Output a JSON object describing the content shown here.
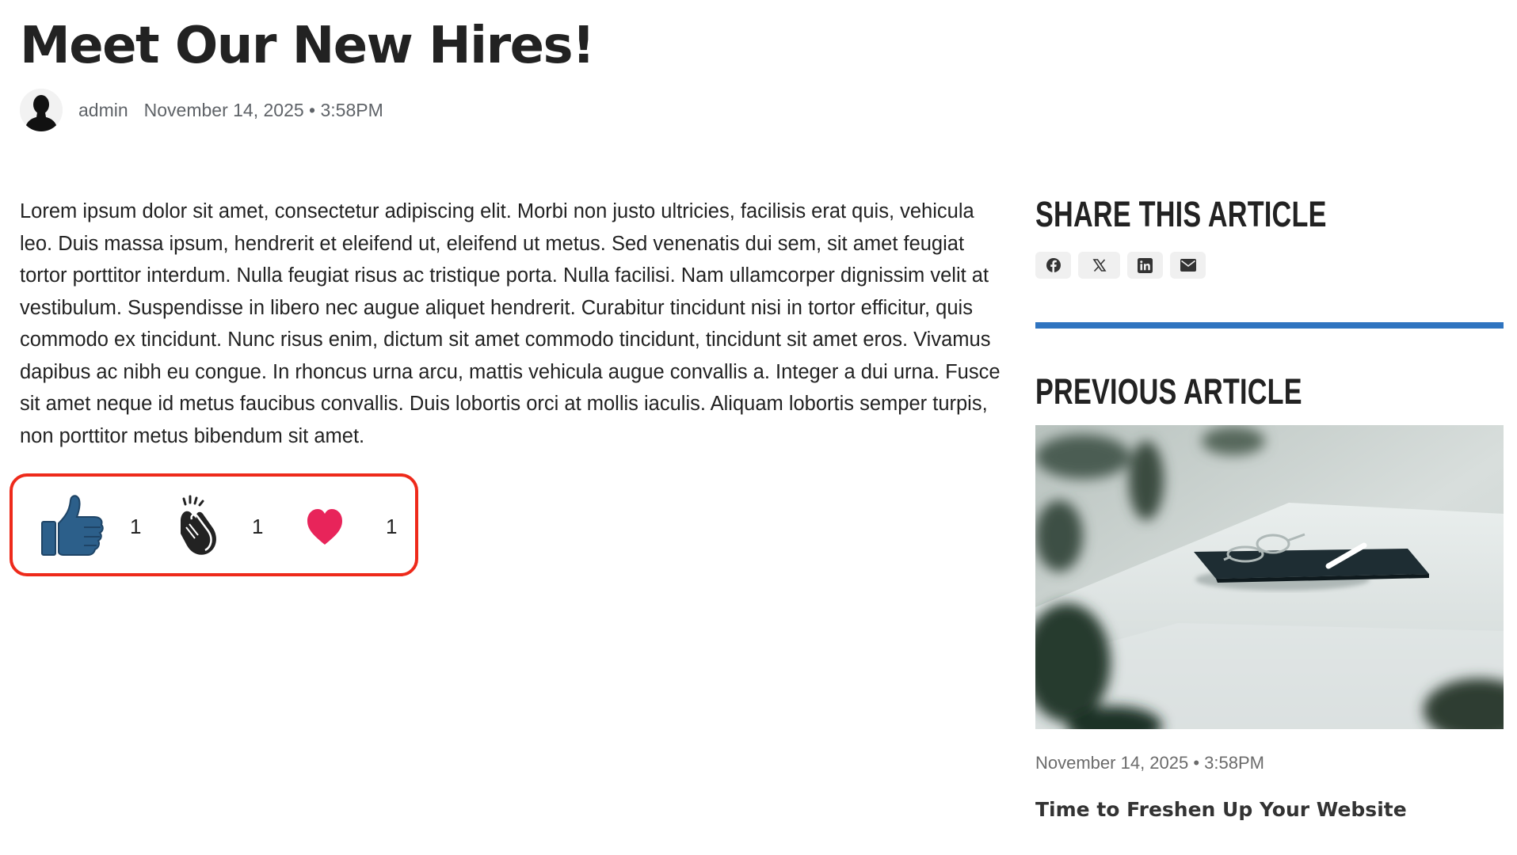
{
  "post": {
    "title": "Meet Our New Hires!",
    "author": "admin",
    "date": "November 14, 2025 • 3:58PM",
    "body": "Lorem ipsum dolor sit amet, consectetur adipiscing elit. Morbi non justo ultricies, facilisis erat quis, vehicula leo. Duis massa ipsum, hendrerit et eleifend ut, eleifend ut metus. Sed venenatis dui sem, sit amet feugiat tortor porttitor interdum. Nulla feugiat risus ac tristique porta. Nulla facilisi. Nam ullamcorper dignissim velit at vestibulum. Suspendisse in libero nec augue aliquet hendrerit. Curabitur tincidunt nisi in tortor efficitur, quis commodo ex tincidunt. Nunc risus enim, dictum sit amet commodo tincidunt, tincidunt sit amet eros. Vivamus dapibus ac nibh eu congue. In rhoncus urna arcu, mattis vehicula augue convallis a. Integer a dui urna. Fusce sit amet neque id metus faucibus convallis. Duis lobortis orci at mollis iaculis. Aliquam lobortis semper turpis, non porttitor metus bibendum sit amet."
  },
  "reactions": [
    {
      "icon": "thumbs-up-icon",
      "count": "1"
    },
    {
      "icon": "clapping-hands-icon",
      "count": "1"
    },
    {
      "icon": "heart-icon",
      "count": "1"
    }
  ],
  "sidebar": {
    "share_heading": "SHARE THIS ARTICLE",
    "share_buttons": [
      "facebook-icon",
      "x-icon",
      "linkedin-icon",
      "envelope-icon"
    ],
    "previous_heading": "PREVIOUS ARTICLE",
    "previous_article": {
      "date": "November 14, 2025 • 3:58PM",
      "title": "Time to Freshen Up Your Website"
    }
  },
  "colors": {
    "accent_divider": "#2f74c0",
    "reaction_highlight": "#ee2a1b",
    "thumbs_up": "#2c5f8a",
    "heart": "#e8245a"
  }
}
